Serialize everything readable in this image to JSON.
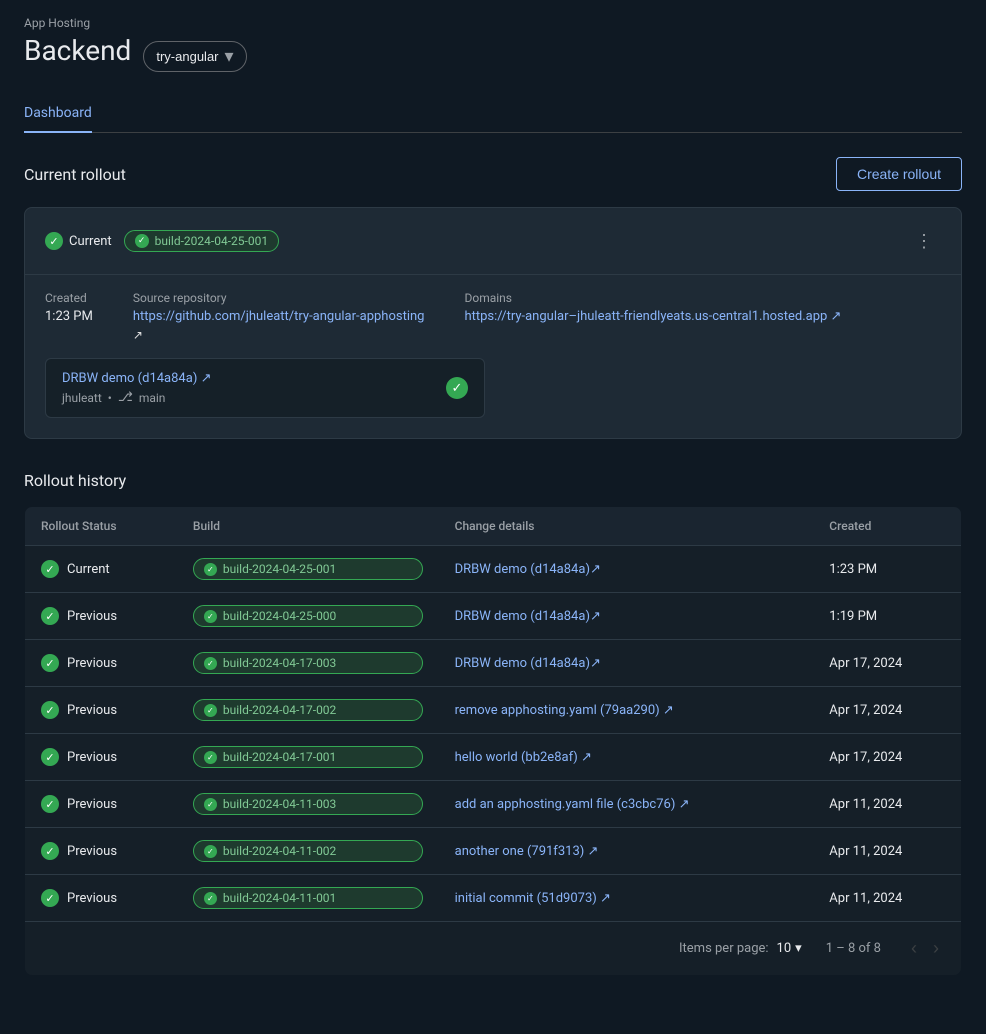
{
  "app": {
    "hosting_label": "App Hosting",
    "title": "Backend"
  },
  "branch_selector": {
    "label": "try-angular"
  },
  "nav": {
    "tabs": [
      {
        "label": "Dashboard",
        "active": true
      }
    ]
  },
  "current_rollout": {
    "section_title": "Current rollout",
    "create_button": "Create rollout",
    "status_label": "Current",
    "build_id": "build-2024-04-25-001",
    "created_label": "Created",
    "created_value": "1:23 PM",
    "source_repo_label": "Source repository",
    "source_repo_url": "https://github.com/jhuleatt/try-angular-apphosting",
    "source_repo_display": "https://github.com/jhuleatt/try-angular-apphosting ",
    "domains_label": "Domains",
    "domain_url": "https://try-angular–jhuleatt-friendlyeats.us-central1.hosted.app",
    "domain_display": "https://try-angular–jhuleatt-friendlyeats.us-central1.hosted.app ",
    "commit_link_text": "DRBW demo (d14a84a) ",
    "commit_author": "jhuleatt",
    "commit_branch": "main",
    "more_options": "⋮"
  },
  "rollout_history": {
    "section_title": "Rollout history",
    "columns": [
      "Rollout Status",
      "Build",
      "Change details",
      "Created"
    ],
    "rows": [
      {
        "status": "Current",
        "build": "build-2024-04-25-001",
        "change_text": "DRBW demo (d14a84a)",
        "created": "1:23 PM"
      },
      {
        "status": "Previous",
        "build": "build-2024-04-25-000",
        "change_text": "DRBW demo (d14a84a)",
        "created": "1:19 PM"
      },
      {
        "status": "Previous",
        "build": "build-2024-04-17-003",
        "change_text": "DRBW demo (d14a84a)",
        "created": "Apr 17, 2024"
      },
      {
        "status": "Previous",
        "build": "build-2024-04-17-002",
        "change_text": "remove apphosting.yaml (79aa290) ",
        "created": "Apr 17, 2024"
      },
      {
        "status": "Previous",
        "build": "build-2024-04-17-001",
        "change_text": "hello world (bb2e8af) ",
        "created": "Apr 17, 2024"
      },
      {
        "status": "Previous",
        "build": "build-2024-04-11-003",
        "change_text": "add an apphosting.yaml file (c3cbc76) ",
        "created": "Apr 11, 2024"
      },
      {
        "status": "Previous",
        "build": "build-2024-04-11-002",
        "change_text": "another one (791f313) ",
        "created": "Apr 11, 2024"
      },
      {
        "status": "Previous",
        "build": "build-2024-04-11-001",
        "change_text": "initial commit (51d9073) ",
        "created": "Apr 11, 2024"
      }
    ]
  },
  "pagination": {
    "items_per_page_label": "Items per page:",
    "items_per_page_value": "10",
    "range_label": "1 – 8 of 8"
  }
}
